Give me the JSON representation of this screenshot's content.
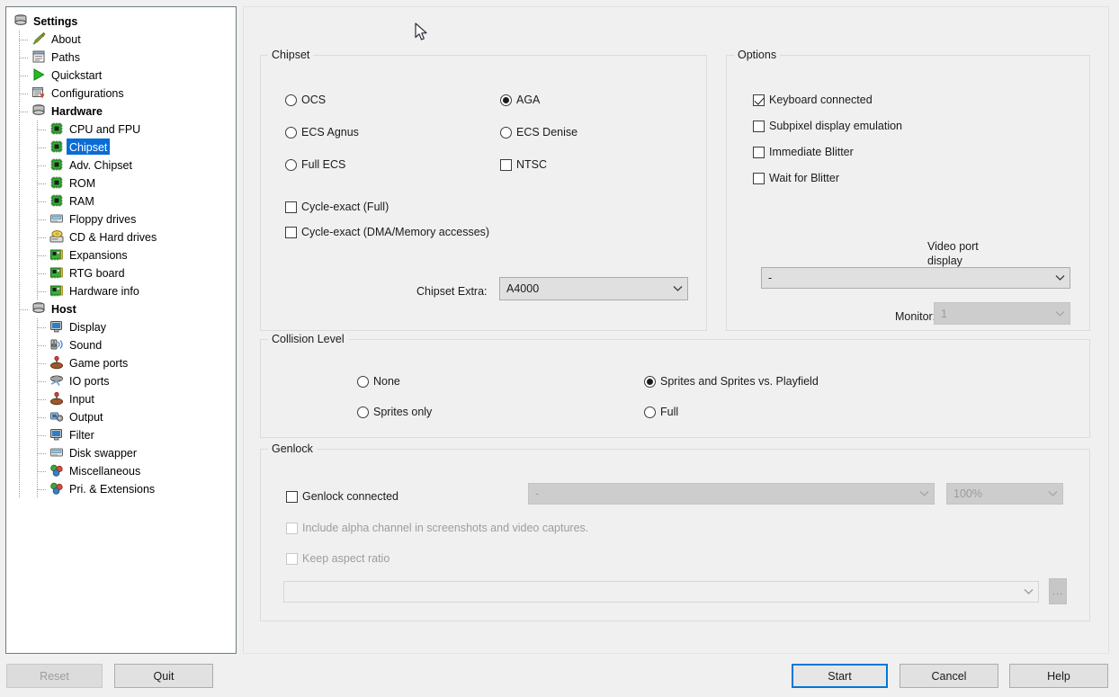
{
  "window": {
    "title": "Settings"
  },
  "sidebar": {
    "items": [
      {
        "label": "Settings",
        "icon": "stack-icon",
        "depth": 0,
        "bold": true,
        "selected": false
      },
      {
        "label": "About",
        "icon": "pencil-icon",
        "depth": 1,
        "bold": false,
        "selected": false
      },
      {
        "label": "Paths",
        "icon": "paths-icon",
        "depth": 1,
        "bold": false,
        "selected": false
      },
      {
        "label": "Quickstart",
        "icon": "play-icon",
        "depth": 1,
        "bold": false,
        "selected": false
      },
      {
        "label": "Configurations",
        "icon": "list-icon",
        "depth": 1,
        "bold": false,
        "selected": false
      },
      {
        "label": "Hardware",
        "icon": "stack-icon",
        "depth": 1,
        "bold": true,
        "selected": false
      },
      {
        "label": "CPU and FPU",
        "icon": "chip-icon",
        "depth": 2,
        "bold": false,
        "selected": false
      },
      {
        "label": "Chipset",
        "icon": "chip-icon",
        "depth": 2,
        "bold": false,
        "selected": true
      },
      {
        "label": "Adv. Chipset",
        "icon": "chip-icon",
        "depth": 2,
        "bold": false,
        "selected": false
      },
      {
        "label": "ROM",
        "icon": "chip-icon",
        "depth": 2,
        "bold": false,
        "selected": false
      },
      {
        "label": "RAM",
        "icon": "chip-icon",
        "depth": 2,
        "bold": false,
        "selected": false
      },
      {
        "label": "Floppy drives",
        "icon": "floppy-icon",
        "depth": 2,
        "bold": false,
        "selected": false
      },
      {
        "label": "CD & Hard drives",
        "icon": "cd-drive-icon",
        "depth": 2,
        "bold": false,
        "selected": false
      },
      {
        "label": "Expansions",
        "icon": "board-icon",
        "depth": 2,
        "bold": false,
        "selected": false
      },
      {
        "label": "RTG board",
        "icon": "board-icon",
        "depth": 2,
        "bold": false,
        "selected": false
      },
      {
        "label": "Hardware info",
        "icon": "board-icon",
        "depth": 2,
        "bold": false,
        "selected": false
      },
      {
        "label": "Host",
        "icon": "stack-icon",
        "depth": 1,
        "bold": true,
        "selected": false
      },
      {
        "label": "Display",
        "icon": "monitor-icon",
        "depth": 2,
        "bold": false,
        "selected": false
      },
      {
        "label": "Sound",
        "icon": "speaker-icon",
        "depth": 2,
        "bold": false,
        "selected": false
      },
      {
        "label": "Game ports",
        "icon": "joystick-icon",
        "depth": 2,
        "bold": false,
        "selected": false
      },
      {
        "label": "IO ports",
        "icon": "ioports-icon",
        "depth": 2,
        "bold": false,
        "selected": false
      },
      {
        "label": "Input",
        "icon": "joystick-icon",
        "depth": 2,
        "bold": false,
        "selected": false
      },
      {
        "label": "Output",
        "icon": "output-icon",
        "depth": 2,
        "bold": false,
        "selected": false
      },
      {
        "label": "Filter",
        "icon": "monitor-icon",
        "depth": 2,
        "bold": false,
        "selected": false
      },
      {
        "label": "Disk swapper",
        "icon": "floppy-icon",
        "depth": 2,
        "bold": false,
        "selected": false
      },
      {
        "label": "Miscellaneous",
        "icon": "spheres-icon",
        "depth": 2,
        "bold": false,
        "selected": false
      },
      {
        "label": "Pri. & Extensions",
        "icon": "spheres-icon",
        "depth": 2,
        "bold": false,
        "selected": false
      }
    ]
  },
  "chipset": {
    "group_title": "Chipset",
    "ocs": "OCS",
    "ecs_agnus": "ECS Agnus",
    "full_ecs": "Full ECS",
    "aga": "AGA",
    "ecs_denise": "ECS Denise",
    "ntsc": "NTSC",
    "cycle_exact_full": "Cycle-exact (Full)",
    "cycle_exact_dma": "Cycle-exact (DMA/Memory accesses)",
    "chipset_extra_label": "Chipset Extra:",
    "chipset_extra_value": "A4000",
    "selected_radio": "AGA",
    "ntsc_checked": false,
    "cycle_exact_full_checked": false,
    "cycle_exact_dma_checked": false
  },
  "options": {
    "group_title": "Options",
    "keyboard_connected": "Keyboard connected",
    "keyboard_connected_checked": true,
    "subpixel": "Subpixel display emulation",
    "subpixel_checked": false,
    "immediate_blitter": "Immediate Blitter",
    "immediate_blitter_checked": false,
    "wait_for_blitter": "Wait for Blitter",
    "wait_for_blitter_checked": false,
    "video_port_label": "Video port display hardware:",
    "video_port_value": "-",
    "monitor_label": "Monitor:",
    "monitor_value": "1",
    "monitor_disabled": true
  },
  "collision": {
    "group_title": "Collision Level",
    "none": "None",
    "sprites_only": "Sprites only",
    "sprites_and_playfield": "Sprites and Sprites vs. Playfield",
    "full": "Full",
    "selected": "Sprites and Sprites vs. Playfield"
  },
  "genlock": {
    "group_title": "Genlock",
    "connected": "Genlock connected",
    "connected_checked": false,
    "device_value": "-",
    "scale_value": "100%",
    "alpha_channel": "Include alpha channel in screenshots and video captures.",
    "alpha_channel_checked": false,
    "keep_aspect": "Keep aspect ratio",
    "keep_aspect_checked": false,
    "file_value": "",
    "browse_label": "..."
  },
  "footer": {
    "reset": "Reset",
    "reset_disabled": true,
    "quit": "Quit",
    "start": "Start",
    "start_focused": true,
    "cancel": "Cancel",
    "help": "Help"
  },
  "colors": {
    "selection": "#0a6cd4",
    "focus": "#0078d7",
    "window_bg": "#f0f0f0"
  }
}
